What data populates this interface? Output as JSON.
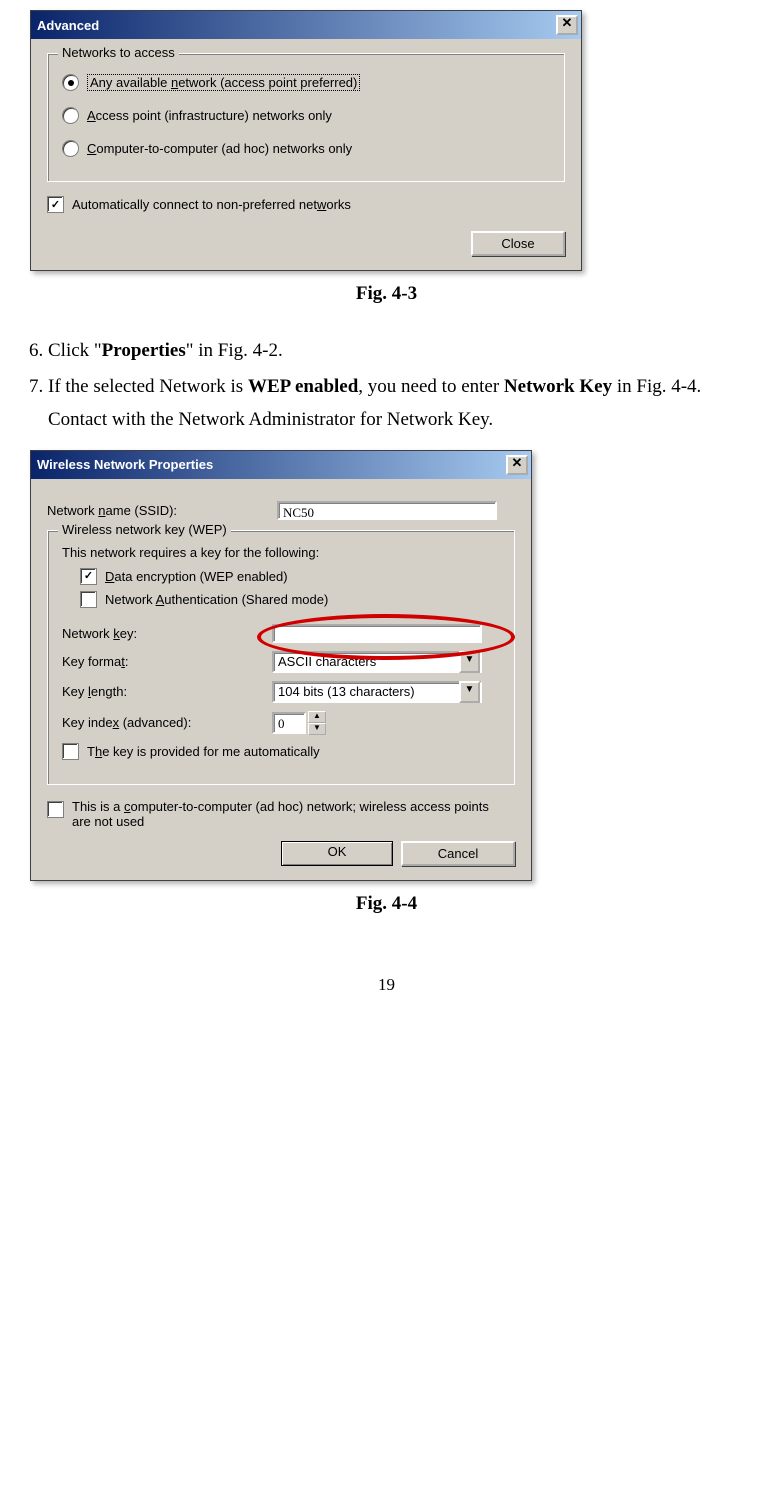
{
  "dlg1": {
    "title": "Advanced",
    "group_legend": "Networks to access",
    "opts": {
      "opt1_pre": "Any available ",
      "opt1_u": "n",
      "opt1_post": "etwork (access point preferred)",
      "opt2_u": "A",
      "opt2_post": "ccess point (infrastructure) networks only",
      "opt3_u": "C",
      "opt3_post": "omputer-to-computer (ad hoc) networks only"
    },
    "auto_pre": "Automatically connect to non-preferred net",
    "auto_u": "w",
    "auto_post": "orks",
    "close": "Close"
  },
  "caption1": "Fig. 4-3",
  "steps": {
    "s6_a": "Click \"",
    "s6_b": "Properties",
    "s6_c": "\" in Fig. 4-2.",
    "s7_a": "If the selected Network is ",
    "s7_b": "WEP enabled",
    "s7_c": ", you need to enter ",
    "s7_d": "Network Key",
    "s7_e": " in Fig. 4-4. Contact with the Network Administrator for Network Key."
  },
  "dlg2": {
    "title": "Wireless Network Properties",
    "ssid_label_pre": "Network ",
    "ssid_label_u": "n",
    "ssid_label_post": "ame (SSID):",
    "ssid_value": "NC50",
    "group_legend": "Wireless network key (WEP)",
    "intro": "This network requires a key for the following:",
    "chk1_u": "D",
    "chk1_post": "ata encryption (WEP enabled)",
    "chk2_pre": "Network ",
    "chk2_u": "A",
    "chk2_post": "uthentication (Shared mode)",
    "netkey_pre": "Network ",
    "netkey_u": "k",
    "netkey_post": "ey:",
    "keyfmt_pre": "Key forma",
    "keyfmt_u": "t",
    "keyfmt_post": ":",
    "keyfmt_val": "ASCII characters",
    "keylen_pre": "Key ",
    "keylen_u": "l",
    "keylen_post": "ength:",
    "keylen_val": "104 bits (13 characters)",
    "keyidx_pre": "Key inde",
    "keyidx_u": "x",
    "keyidx_post": " (advanced):",
    "keyidx_val": "0",
    "auto_pre": "T",
    "auto_u": "h",
    "auto_post": "e key is provided for me automatically",
    "adhoc_pre": "This is a ",
    "adhoc_u": "c",
    "adhoc_post": "omputer-to-computer (ad hoc) network; wireless access points are not used",
    "ok": "OK",
    "cancel": "Cancel"
  },
  "caption2": "Fig. 4-4",
  "page_number": "19"
}
